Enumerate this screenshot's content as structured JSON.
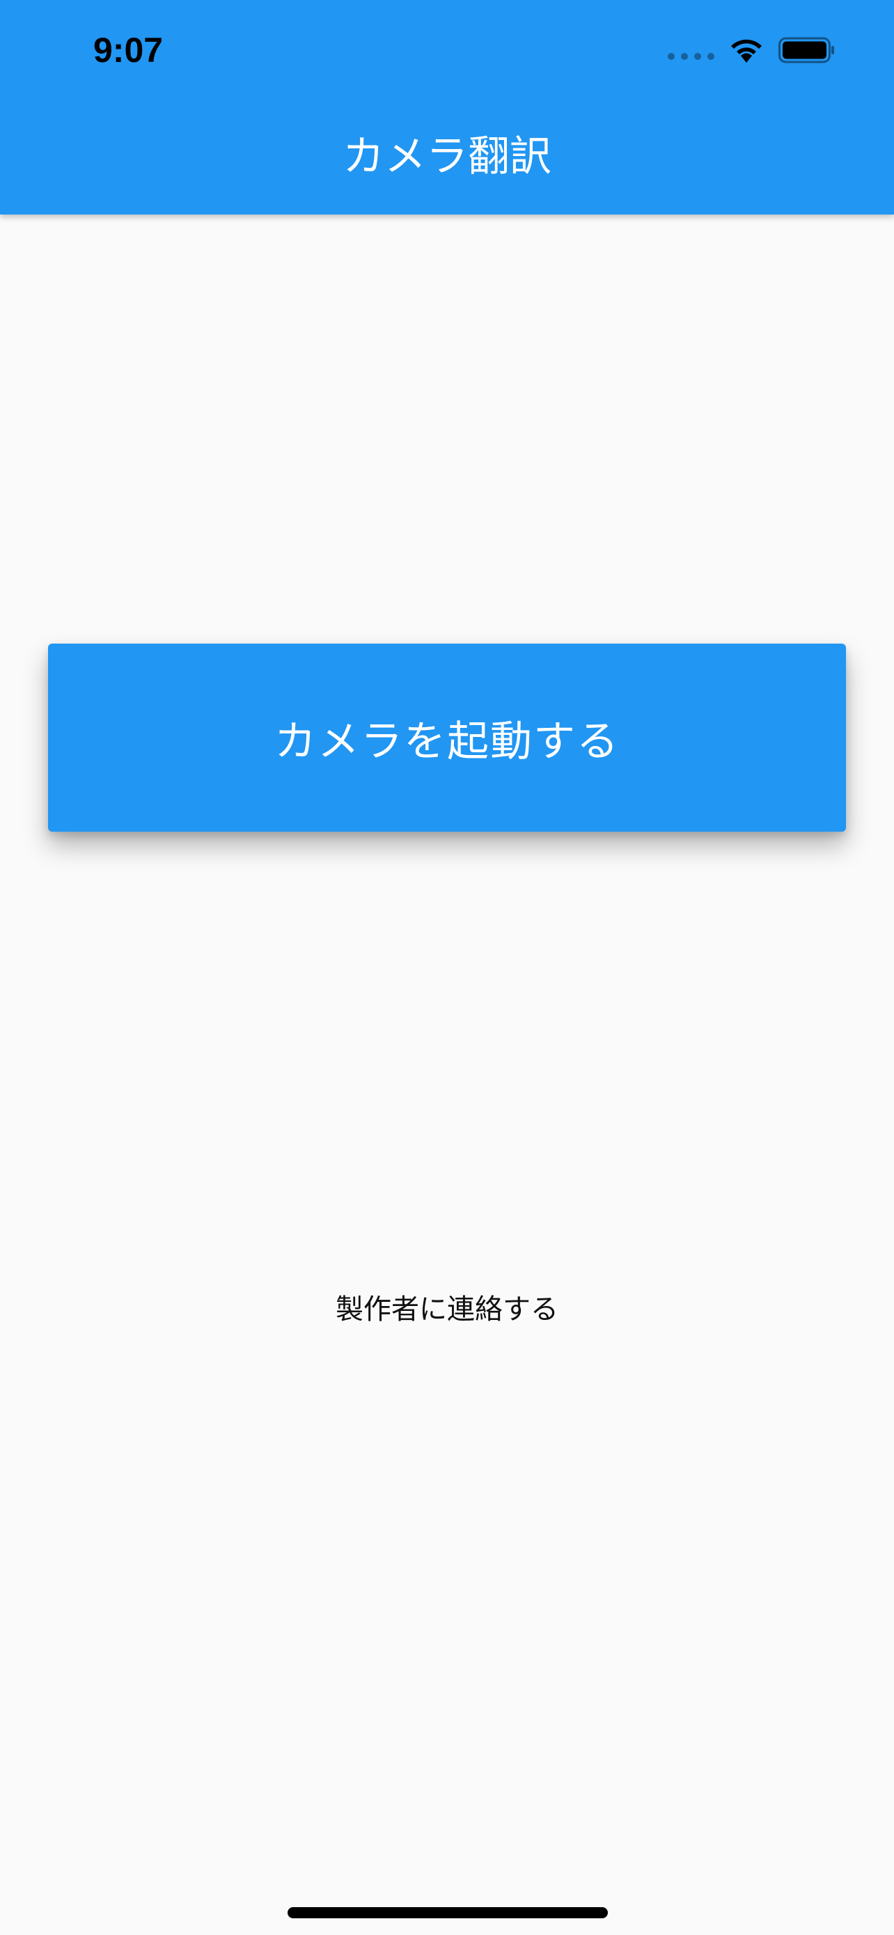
{
  "status_bar": {
    "time": "9:07",
    "icons": [
      "signal-icon",
      "wifi-icon",
      "battery-icon"
    ]
  },
  "app_bar": {
    "title": "カメラ翻訳",
    "color": "#2196f3"
  },
  "main": {
    "camera_button_label": "カメラを起動する",
    "contact_link_label": "製作者に連絡する"
  }
}
